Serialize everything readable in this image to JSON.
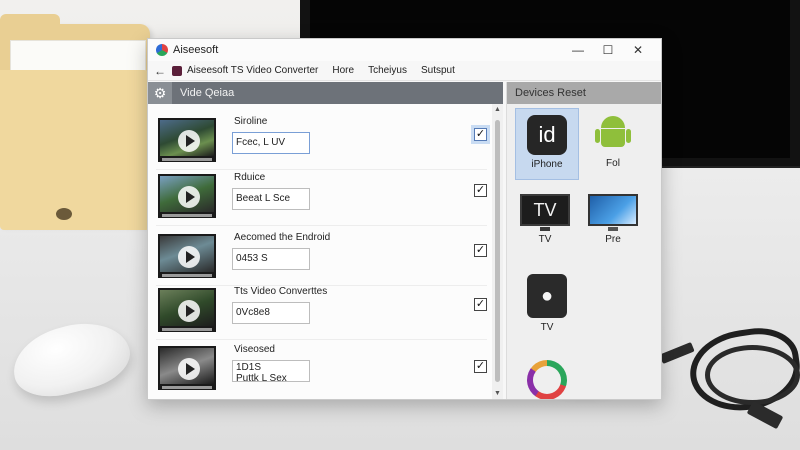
{
  "window": {
    "app_name": "Aiseesoft",
    "menu_title": "Aiseesoft TS Video Converter",
    "menu_items": [
      "Hore",
      "Tcheiyus",
      "Sutsput"
    ],
    "controls": {
      "minimize": "—",
      "maximize": "☐",
      "close": "✕"
    },
    "back": "←"
  },
  "left_pane": {
    "header": "Vide Qeiaa",
    "rows": [
      {
        "label": "Siroline",
        "value": "Fcec, L UV",
        "checked": "✓"
      },
      {
        "label": "Rduice",
        "value": "Beeat L Sce",
        "checked": "✓"
      },
      {
        "label": "Aecomed the Endroid",
        "value": "0453 S",
        "checked": "✓"
      },
      {
        "label": "Tts Video Converttes",
        "value": "0Vc8e8",
        "checked": "✓"
      },
      {
        "label": "Viseosed",
        "value_line1": "1D1S",
        "value_line2": "Puttk L Sex",
        "checked": "✓"
      }
    ]
  },
  "right_pane": {
    "header": "Devices Reset",
    "devices": [
      {
        "label": "iPhone",
        "icon_text": "id",
        "icon": "iphone-icon"
      },
      {
        "label": "Fol",
        "icon": "android-icon"
      },
      {
        "label": "TV",
        "icon_text": "TV",
        "icon": "tv-icon"
      },
      {
        "label": "Pre",
        "icon": "monitor-icon"
      },
      {
        "label": "TV",
        "icon_text": "",
        "icon": "apple-tv-icon"
      }
    ]
  },
  "colors": {
    "accent": "#c7d9ef",
    "header_dark": "#6d7279",
    "header_light": "#a9a9a9"
  }
}
